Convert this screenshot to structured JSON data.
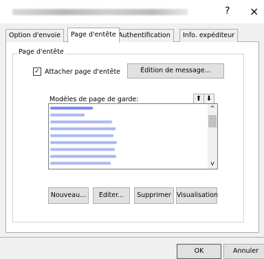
{
  "titlebar": {
    "help_label": "?",
    "close_label": "×"
  },
  "tabs": [
    {
      "label": "Option d'envoie"
    },
    {
      "label": "Page d'entête"
    },
    {
      "label": "Authentification"
    },
    {
      "label": "Info. expéditeur"
    }
  ],
  "group": {
    "label": "Page d'entête",
    "checkbox_label": "Attacher page d'entête",
    "checkbox_checked": true,
    "edit_message_label": "Édition de message...",
    "list_label": "Modèles de page de garde:",
    "move_up_icon": "arrow-up-icon",
    "move_down_icon": "arrow-down-icon",
    "buttons": {
      "new": "Nouveau...",
      "edit": "Editer...",
      "delete": "Supprimer",
      "preview": "Visualisation"
    }
  },
  "footer": {
    "ok": "OK",
    "cancel": "Annuler"
  }
}
